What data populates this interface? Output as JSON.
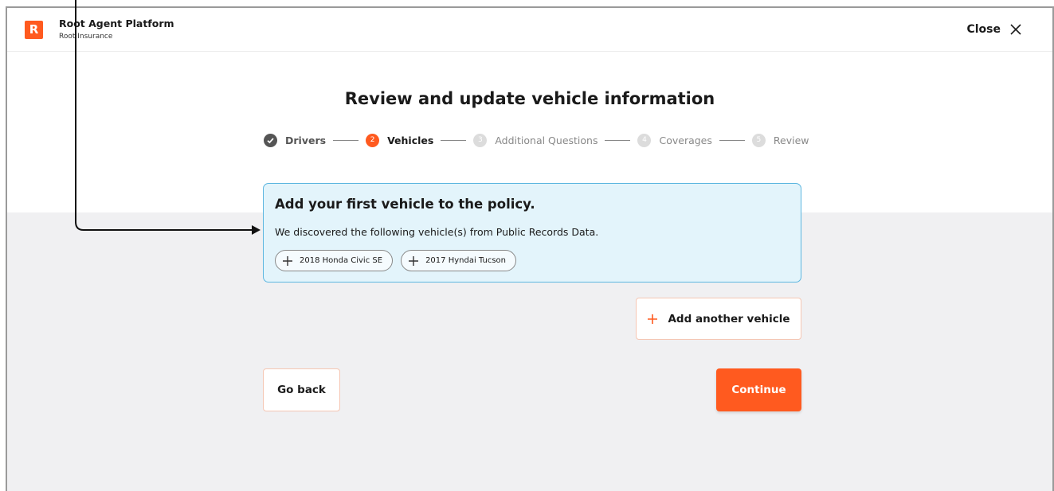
{
  "header": {
    "logo_letter": "R",
    "app_title": "Root Agent Platform",
    "app_subtitle": "Root Insurance",
    "close_label": "Close"
  },
  "page": {
    "title": "Review and update vehicle information"
  },
  "stepper": {
    "steps": [
      {
        "number": "",
        "label": "Drivers",
        "state": "done"
      },
      {
        "number": "2",
        "label": "Vehicles",
        "state": "active"
      },
      {
        "number": "3",
        "label": "Additional Questions",
        "state": "todo"
      },
      {
        "number": "4",
        "label": "Coverages",
        "state": "todo"
      },
      {
        "number": "5",
        "label": "Review",
        "state": "todo"
      }
    ]
  },
  "vehicle_card": {
    "title": "Add your first vehicle to the policy.",
    "description": "We discovered the following vehicle(s) from Public Records Data.",
    "vehicles": [
      {
        "label": "2018 Honda Civic SE"
      },
      {
        "label": "2017 Hyndai Tucson"
      }
    ]
  },
  "actions": {
    "add_vehicle_label": "Add another vehicle",
    "back_label": "Go back",
    "continue_label": "Continue"
  },
  "colors": {
    "accent": "#ff5a1f",
    "card_bg": "#e3f4fb",
    "card_border": "#5cb6e0",
    "page_bg": "#f0f0f2"
  },
  "icons": {
    "close": "close-icon",
    "done": "check-circle-icon",
    "add": "plus-icon"
  }
}
